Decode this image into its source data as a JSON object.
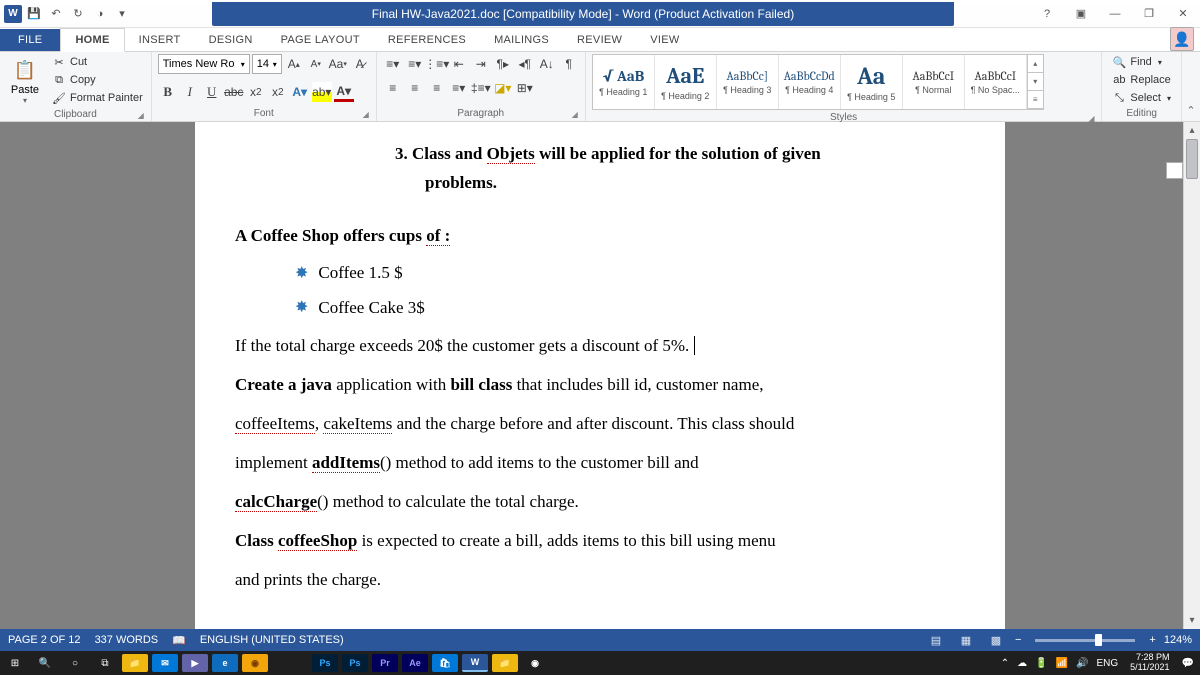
{
  "titlebar": {
    "title": "Final HW-Java2021.doc [Compatibility Mode] - Word (Product Activation Failed)"
  },
  "tabs": {
    "file": "FILE",
    "home": "HOME",
    "insert": "INSERT",
    "design": "DESIGN",
    "page_layout": "PAGE LAYOUT",
    "references": "REFERENCES",
    "mailings": "MAILINGS",
    "review": "REVIEW",
    "view": "VIEW"
  },
  "clipboard": {
    "paste": "Paste",
    "cut": "Cut",
    "copy": "Copy",
    "format_painter": "Format Painter",
    "label": "Clipboard"
  },
  "font": {
    "name": "Times New Ro",
    "size": "14",
    "case": "Aa",
    "label": "Font",
    "b": "B",
    "i": "I",
    "u": "U"
  },
  "paragraph": {
    "label": "Paragraph"
  },
  "styles": {
    "label": "Styles",
    "items": [
      {
        "preview": "√ AaB",
        "name": "¶ Heading 1",
        "cls": "blue"
      },
      {
        "preview": "AaE",
        "name": "¶ Heading 2",
        "cls": "blue"
      },
      {
        "preview": "AaBbCc]",
        "name": "¶ Heading 3",
        "cls": "blue"
      },
      {
        "preview": "AaBbCcDd",
        "name": "¶ Heading 4",
        "cls": "blue"
      },
      {
        "preview": "Aa",
        "name": "¶ Heading 5",
        "cls": "blue"
      },
      {
        "preview": "AaBbCcI",
        "name": "¶ Normal",
        "cls": ""
      },
      {
        "preview": "AaBbCcI",
        "name": "¶ No Spac...",
        "cls": ""
      }
    ]
  },
  "editing": {
    "find": "Find",
    "replace": "Replace",
    "select": "Select",
    "label": "Editing"
  },
  "document": {
    "list_num": "3.",
    "list_line1_a": "Class and ",
    "list_line1_b": "Objets",
    "list_line1_c": " will be applied for the solution of given",
    "list_line2": "problems.",
    "h4": "A Coffee Shop offers cups ",
    "h4_u": "of :",
    "b1": "Coffee 1.5 $",
    "b2": "Coffee Cake 3$",
    "p1": "If the total charge exceeds 20$ the customer gets a discount of 5%.",
    "p2a": "Create a java",
    "p2b": " application with ",
    "p2c": "bill class",
    "p2d": " that includes bill id, customer name,",
    "p3a": "coffeeItems",
    "p3b": ", ",
    "p3c": "cakeItems",
    "p3d": " and the charge before and after discount. This class should",
    "p4a": "implement ",
    "p4b": "addItems",
    "p4c": "() method to add items to the customer bill and",
    "p5a": "calcCharge",
    "p5b": "() method to calculate the total charge.",
    "p6a": "Class ",
    "p6b": "coffeeShop",
    "p6c": " is expected to create a bill, adds items to this bill using menu",
    "p7": "and prints the charge."
  },
  "status": {
    "page": "PAGE 2 OF 12",
    "words": "337 WORDS",
    "lang": "ENGLISH (UNITED STATES)",
    "zoom": "124%"
  },
  "tray": {
    "lang": "ENG",
    "time": "7:28 PM",
    "date": "5/11/2021"
  }
}
